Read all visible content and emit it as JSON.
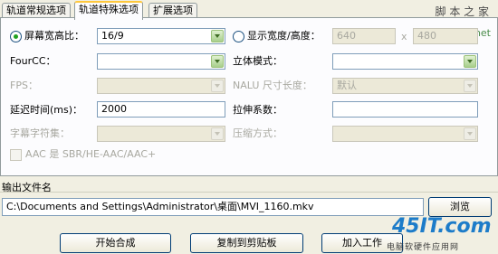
{
  "tabs": [
    "轨道常规选项",
    "轨道特殊选项",
    "扩展选项"
  ],
  "watermark": {
    "top": "脚 本 之 家",
    "url": "www.Jb51.net"
  },
  "aspect": {
    "radio_label": "屏幕宽高比：",
    "value": "16/9"
  },
  "display_size": {
    "radio_label": "显示宽度/高度：",
    "width": "640",
    "sep": "x",
    "height": "480"
  },
  "fourcc": {
    "label": "FourCC：",
    "value": ""
  },
  "stereo": {
    "label": "立体模式：",
    "value": ""
  },
  "fps": {
    "label": "FPS：",
    "value": ""
  },
  "nalu": {
    "label": "NALU 尺寸长度：",
    "value": "默认"
  },
  "delay": {
    "label": "延迟时间(ms)：",
    "value": "2000"
  },
  "stretch": {
    "label": "拉伸系数：",
    "value": ""
  },
  "subtitle_charset": {
    "label": "字幕字符集：",
    "value": ""
  },
  "compression": {
    "label": "压缩方式：",
    "value": ""
  },
  "aac": {
    "label": "AAC 是 SBR/HE-AAC/AAC+"
  },
  "output": {
    "group_title": "输出文件名",
    "path": "C:\\Documents and Settings\\Administrator\\桌面\\MVI_1160.mkv",
    "browse": "浏览"
  },
  "buttons": {
    "start": "开始合成",
    "copy": "复制到剪贴板",
    "add_job": "加入工作"
  },
  "logo": {
    "text": "45IT.com",
    "subtitle": "电脑软硬件应用网"
  }
}
